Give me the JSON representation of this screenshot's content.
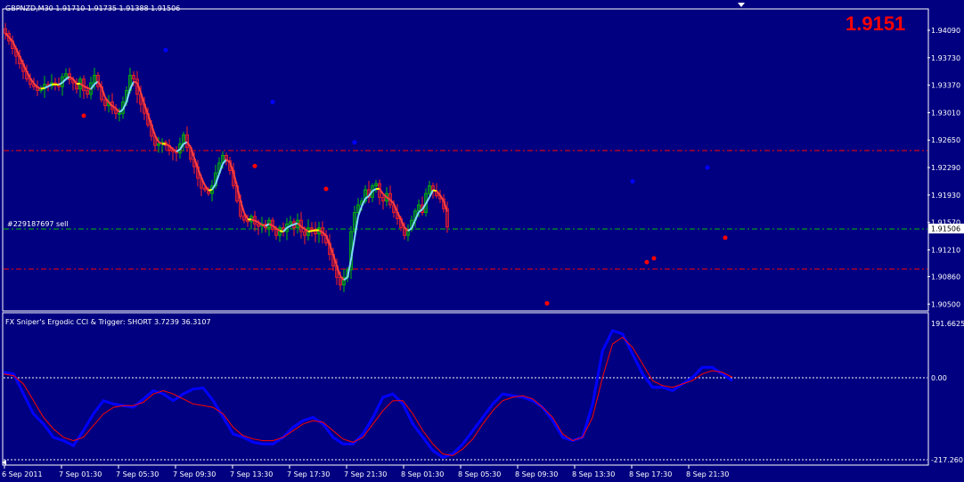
{
  "header": {
    "symbol_text": "GBPNZD,M30  1.91710 1.91735 1.91388 1.91506",
    "big_price": "1.9151",
    "order_label": "#229187697 sell",
    "indicator_text": "FX Sniper's Ergodic CCI & Trigger: SHORT 3.7239 36.3107"
  },
  "colors": {
    "background": "#000080",
    "grid_frame": "#ffffff",
    "bull_candle": "#00c000",
    "bear_candle": "#ff2020",
    "ma_up": "#ffff00",
    "ma_down": "#ff4040",
    "ma_flat": "#80d8ff",
    "cci": "#0000ff",
    "trigger": "#ff0000",
    "hline_red": "#ff0000",
    "hline_green": "#00c000",
    "fractal_up": "#0000ff",
    "fractal_down": "#ff0000"
  },
  "chart_data": [
    {
      "type": "candlestick",
      "title": "GBPNZD,M30",
      "price_axis_labels": [
        "1.94090",
        "1.93730",
        "1.93370",
        "1.93010",
        "1.92650",
        "1.92290",
        "1.91930",
        "1.91570",
        "1.91210",
        "1.90860",
        "1.90500"
      ],
      "current_price_label": "1.91506",
      "ylim": [
        1.9041,
        1.9437
      ],
      "time_labels": [
        "6 Sep 2011",
        "7 Sep 01:30",
        "7 Sep 05:30",
        "7 Sep 09:30",
        "7 Sep 13:30",
        "7 Sep 17:30",
        "7 Sep 21:30",
        "8 Sep 01:30",
        "8 Sep 05:30",
        "8 Sep 09:30",
        "8 Sep 13:30",
        "8 Sep 17:30",
        "8 Sep 21:30"
      ],
      "horizontal_lines": [
        {
          "price": 1.9247,
          "style": "dash-dot",
          "color": "red"
        },
        {
          "price": 1.91506,
          "style": "dash-dot",
          "color": "green"
        },
        {
          "price": 1.91,
          "style": "dash-dot",
          "color": "red"
        }
      ],
      "closes": [
        1.9405,
        1.9395,
        1.9385,
        1.9375,
        1.9365,
        1.9355,
        1.9345,
        1.9338,
        1.9335,
        1.933,
        1.9332,
        1.9338,
        1.9336,
        1.934,
        1.9338,
        1.9335,
        1.9348,
        1.9352,
        1.9344,
        1.934,
        1.9332,
        1.9345,
        1.933,
        1.9325,
        1.934,
        1.935,
        1.9335,
        1.9318,
        1.931,
        1.9315,
        1.9305,
        1.93,
        1.93,
        1.9315,
        1.933,
        1.935,
        1.9345,
        1.9325,
        1.9312,
        1.93,
        1.9285,
        1.927,
        1.9258,
        1.926,
        1.9262,
        1.9258,
        1.9252,
        1.925,
        1.9248,
        1.926,
        1.9272,
        1.9255,
        1.924,
        1.923,
        1.9215,
        1.9202,
        1.92,
        1.9195,
        1.9205,
        1.9222,
        1.9235,
        1.9245,
        1.9238,
        1.9225,
        1.9205,
        1.9185,
        1.9165,
        1.916,
        1.9158,
        1.9165,
        1.9155,
        1.9152,
        1.9155,
        1.915,
        1.916,
        1.9148,
        1.914,
        1.915,
        1.9145,
        1.9155,
        1.9158,
        1.915,
        1.916,
        1.9145,
        1.914,
        1.915,
        1.9148,
        1.9142,
        1.915,
        1.914,
        1.913,
        1.9115,
        1.91,
        1.9085,
        1.9075,
        1.9085,
        1.9095,
        1.9145,
        1.917,
        1.918,
        1.9185,
        1.92,
        1.919,
        1.9205,
        1.9208,
        1.919,
        1.9185,
        1.9195,
        1.918,
        1.917,
        1.9162,
        1.915,
        1.914,
        1.9148,
        1.916,
        1.9172,
        1.918,
        1.917,
        1.9195,
        1.9205,
        1.9198,
        1.9192,
        1.9188,
        1.9175,
        1.9151
      ],
      "fractals_up": [
        [
          45,
          1.9383
        ],
        [
          75,
          1.9315
        ],
        [
          98,
          1.9262
        ],
        [
          176,
          1.9211
        ],
        [
          197,
          1.9229
        ]
      ],
      "fractals_down": [
        [
          22,
          1.9297
        ],
        [
          70,
          1.9231
        ],
        [
          90,
          1.9201
        ],
        [
          152,
          1.9051
        ],
        [
          180,
          1.9105
        ],
        [
          182,
          1.911
        ],
        [
          202,
          1.9137
        ]
      ]
    },
    {
      "type": "line",
      "title": "FX Sniper's Ergodic CCI & Trigger: SHORT 3.7239 36.3107",
      "axis_labels": [
        "191.6625",
        "0.00",
        "-217.260"
      ],
      "ylim": [
        -217.26,
        191.6625
      ],
      "series": [
        {
          "name": "CCI",
          "values": [
            45,
            40,
            -20,
            -80,
            -110,
            -150,
            -160,
            -175,
            -130,
            -80,
            -40,
            -50,
            -55,
            -60,
            -35,
            -10,
            -20,
            -40,
            -20,
            -5,
            -2,
            -40,
            -90,
            -140,
            -150,
            -165,
            -170,
            -170,
            -150,
            -120,
            -100,
            -90,
            -110,
            -150,
            -170,
            -170,
            -140,
            -90,
            -30,
            -20,
            -50,
            -110,
            -150,
            -190,
            -210,
            -200,
            -170,
            -130,
            -90,
            -50,
            -20,
            -25,
            -30,
            -40,
            -60,
            -100,
            -150,
            -160,
            -150,
            -50,
            110,
            170,
            160,
            100,
            40,
            0,
            0,
            -10,
            10,
            30,
            60,
            60,
            40,
            20
          ]
        },
        {
          "name": "Trigger",
          "values": [
            40,
            35,
            10,
            -40,
            -90,
            -125,
            -150,
            -160,
            -150,
            -115,
            -80,
            -60,
            -55,
            -55,
            -45,
            -20,
            -10,
            -20,
            -35,
            -50,
            -55,
            -60,
            -80,
            -120,
            -145,
            -155,
            -160,
            -160,
            -150,
            -130,
            -110,
            -100,
            -105,
            -130,
            -155,
            -165,
            -150,
            -110,
            -70,
            -40,
            -40,
            -80,
            -130,
            -170,
            -200,
            -205,
            -185,
            -155,
            -110,
            -70,
            -40,
            -30,
            -25,
            -35,
            -60,
            -90,
            -140,
            -160,
            -150,
            -90,
            30,
            130,
            150,
            120,
            70,
            20,
            5,
            0,
            10,
            20,
            40,
            50,
            45,
            30
          ]
        }
      ]
    }
  ]
}
